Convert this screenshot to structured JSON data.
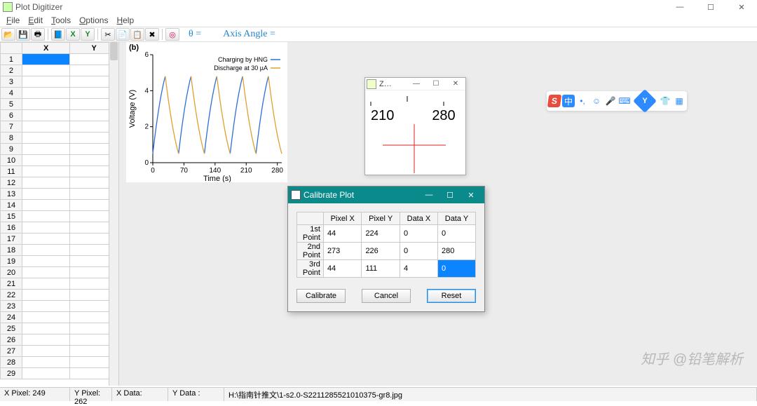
{
  "window": {
    "title": "Plot Digitizer",
    "controls": {
      "min": "—",
      "max": "☐",
      "close": "✕"
    }
  },
  "menu": {
    "items": [
      "File",
      "Edit",
      "Tools",
      "Options",
      "Help"
    ]
  },
  "toolbar": {
    "theta_label": "θ =",
    "axis_angle_label": "Axis Angle ="
  },
  "sheet": {
    "headers": [
      "X",
      "Y"
    ],
    "row_count": 29
  },
  "plot_label": "(b)",
  "chart_data": {
    "type": "line",
    "title": "",
    "xlabel": "Time (s)",
    "ylabel": "Voltage (V)",
    "xticks": [
      0,
      70,
      140,
      210,
      280
    ],
    "yticks": [
      0,
      2,
      4,
      6
    ],
    "xlim": [
      0,
      290
    ],
    "ylim": [
      0,
      6
    ],
    "series": [
      {
        "name": "Charging by HNG",
        "color": "#2e6fd6",
        "x": [
          0,
          28,
          58,
          86,
          116,
          144,
          174,
          202,
          232,
          260
        ],
        "y": [
          0.5,
          4.8,
          0.5,
          4.8,
          0.5,
          4.8,
          0.5,
          4.8,
          0.5,
          4.8
        ]
      },
      {
        "name": "Discharge at 30 µA",
        "color": "#e0a030",
        "x": [
          28,
          58,
          86,
          116,
          144,
          174,
          202,
          232,
          260,
          290
        ],
        "y": [
          4.8,
          0.5,
          4.8,
          0.5,
          4.8,
          0.5,
          4.8,
          0.5,
          4.8,
          0.5
        ]
      }
    ]
  },
  "zoom": {
    "title": "Z…",
    "ticks": [
      "210",
      "280"
    ]
  },
  "dialog": {
    "title": "Calibrate Plot",
    "columns": [
      "Pixel X",
      "Pixel Y",
      "Data X",
      "Data Y"
    ],
    "rows": [
      {
        "label": "1st Point",
        "px": "44",
        "py": "224",
        "dx": "0",
        "dy": "0"
      },
      {
        "label": "2nd Point",
        "px": "273",
        "py": "226",
        "dx": "0",
        "dy": "280"
      },
      {
        "label": "3rd Point",
        "px": "44",
        "py": "111",
        "dx": "4",
        "dy": "0"
      }
    ],
    "selected": {
      "row": 2,
      "col": "dy"
    },
    "buttons": {
      "calibrate": "Calibrate",
      "cancel": "Cancel",
      "reset": "Reset"
    }
  },
  "status": {
    "xpixel_label": "X Pixel:",
    "xpixel": "249",
    "ypixel_label": "Y Pixel:",
    "ypixel": "262",
    "xdata_label": "X Data:",
    "xdata": "",
    "ydata_label": "Y Data :",
    "ydata": "",
    "path": "H:\\指南针推文\\1-s2.0-S2211285521010375-gr8.jpg"
  },
  "watermark": "知乎 @铅笔解析",
  "ime": {
    "cn": "中"
  }
}
